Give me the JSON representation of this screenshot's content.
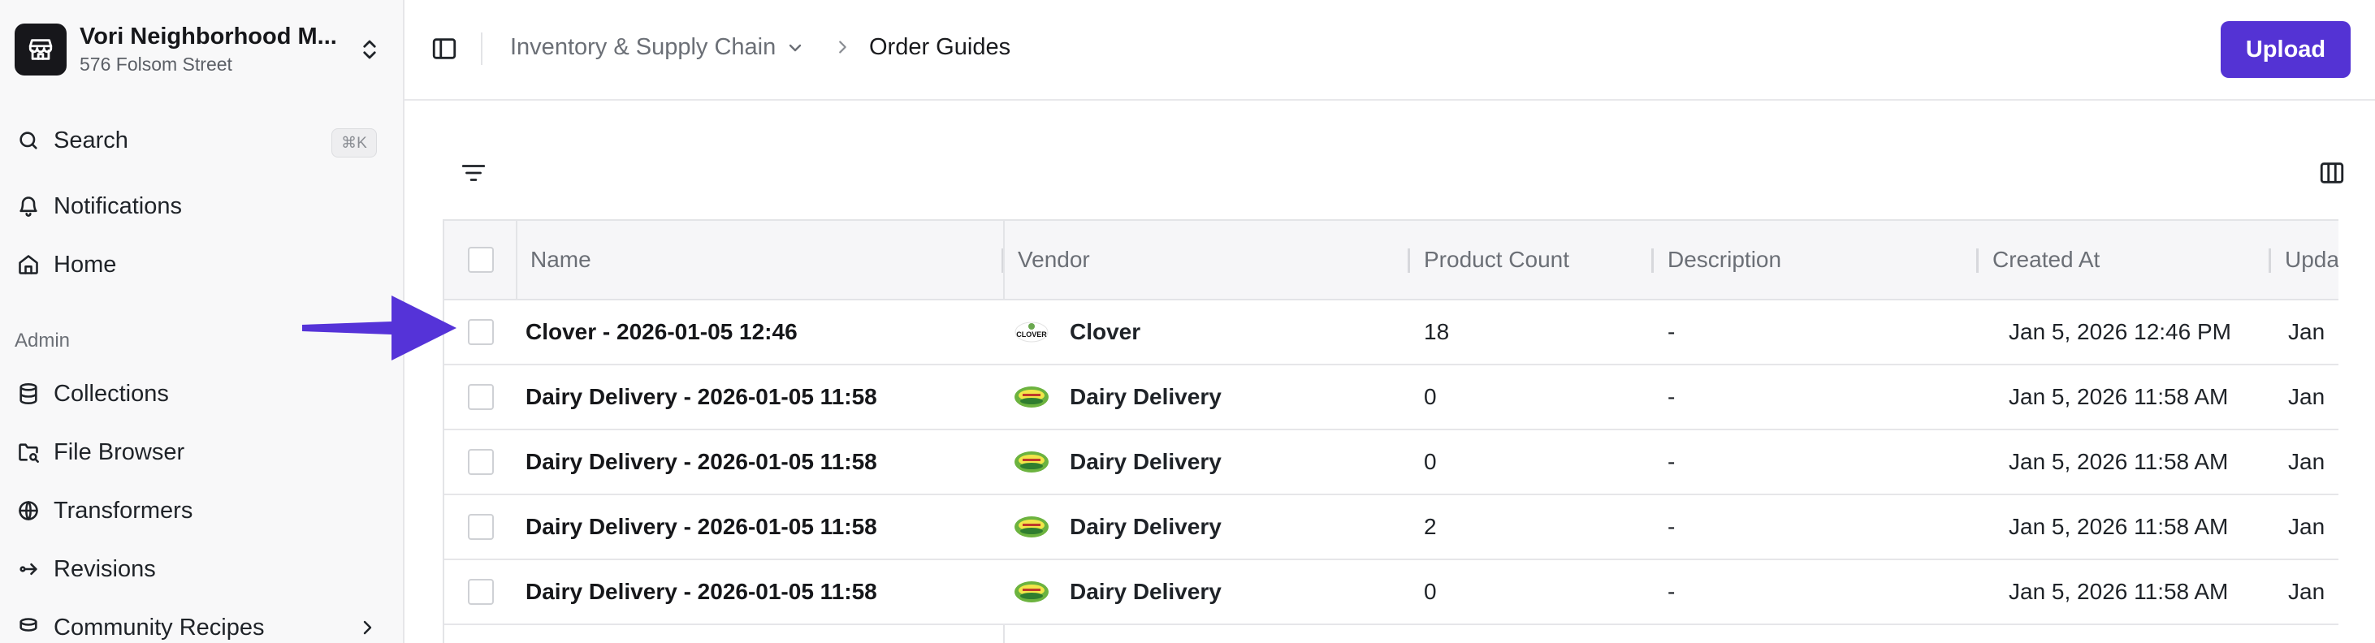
{
  "org": {
    "name": "Vori Neighborhood M...",
    "address": "576 Folsom Street"
  },
  "sidebar": {
    "search_label": "Search",
    "search_shortcut": "⌘K",
    "items_top": [
      {
        "label": "Notifications",
        "icon": "bell-icon"
      },
      {
        "label": "Home",
        "icon": "home-icon"
      }
    ],
    "section_admin": "Admin",
    "items_admin": [
      {
        "label": "Collections",
        "icon": "database-icon"
      },
      {
        "label": "File Browser",
        "icon": "folder-search-icon"
      },
      {
        "label": "Transformers",
        "icon": "transformer-icon"
      },
      {
        "label": "Revisions",
        "icon": "revision-icon"
      },
      {
        "label": "Community Recipes",
        "icon": "community-icon"
      }
    ]
  },
  "header": {
    "breadcrumb_parent": "Inventory & Supply Chain",
    "breadcrumb_current": "Order Guides",
    "upload_label": "Upload"
  },
  "table": {
    "columns": [
      "Name",
      "Vendor",
      "Product Count",
      "Description",
      "Created At",
      "Upda"
    ],
    "rows": [
      {
        "name": "Clover - 2026-01-05 12:46",
        "vendor": "Clover",
        "vendor_logo": "clover-logo",
        "product_count": "18",
        "description": "-",
        "created_at": "Jan 5, 2026 12:46 PM",
        "updated_at": "Jan"
      },
      {
        "name": "Dairy Delivery - 2026-01-05 11:58",
        "vendor": "Dairy Delivery",
        "vendor_logo": "dairy-delivery-logo",
        "product_count": "0",
        "description": "-",
        "created_at": "Jan 5, 2026 11:58 AM",
        "updated_at": "Jan"
      },
      {
        "name": "Dairy Delivery - 2026-01-05 11:58",
        "vendor": "Dairy Delivery",
        "vendor_logo": "dairy-delivery-logo",
        "product_count": "0",
        "description": "-",
        "created_at": "Jan 5, 2026 11:58 AM",
        "updated_at": "Jan"
      },
      {
        "name": "Dairy Delivery - 2026-01-05 11:58",
        "vendor": "Dairy Delivery",
        "vendor_logo": "dairy-delivery-logo",
        "product_count": "2",
        "description": "-",
        "created_at": "Jan 5, 2026 11:58 AM",
        "updated_at": "Jan"
      },
      {
        "name": "Dairy Delivery - 2026-01-05 11:58",
        "vendor": "Dairy Delivery",
        "vendor_logo": "dairy-delivery-logo",
        "product_count": "0",
        "description": "-",
        "created_at": "Jan 5, 2026 11:58 AM",
        "updated_at": "Jan"
      }
    ]
  },
  "colors": {
    "accent": "#5433d4",
    "arrow": "#5533d8"
  }
}
